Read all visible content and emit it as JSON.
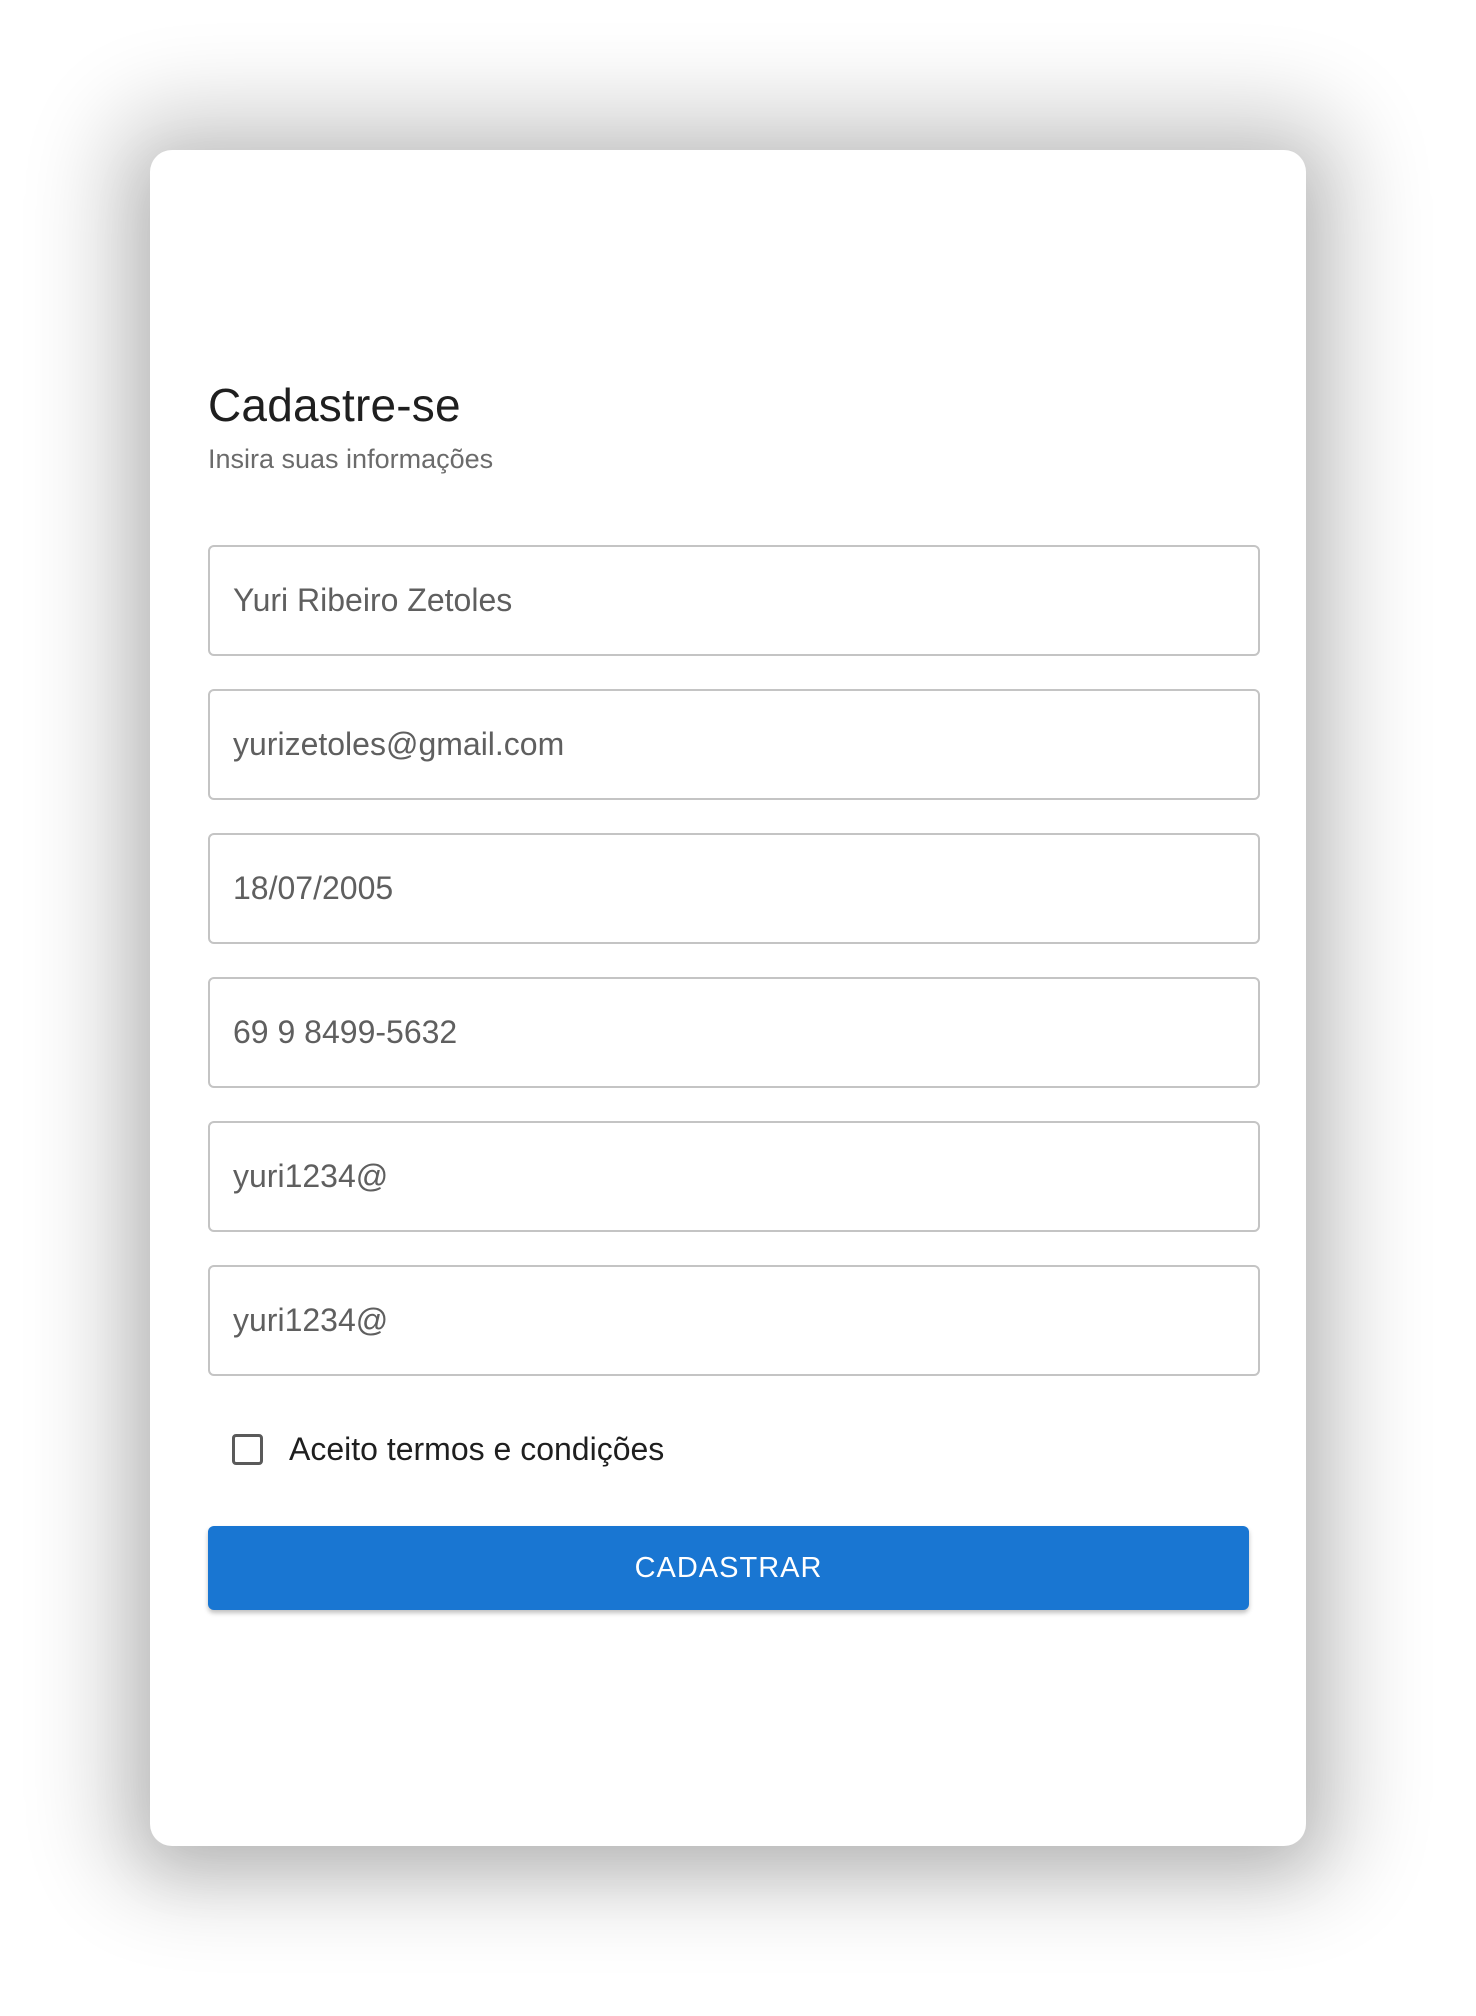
{
  "form": {
    "title": "Cadastre-se",
    "subtitle": "Insira suas informações",
    "fields": [
      {
        "value": "Yuri Ribeiro Zetoles"
      },
      {
        "value": "yurizetoles@gmail.com"
      },
      {
        "value": "18/07/2005"
      },
      {
        "value": "69 9 8499-5632"
      },
      {
        "value": "yuri1234@"
      },
      {
        "value": "yuri1234@"
      }
    ],
    "terms_label": "Aceito termos e condições",
    "terms_checked": false,
    "submit_label": "CADASTRAR"
  },
  "colors": {
    "primary": "#1976d2",
    "border": "#c4c4c4",
    "text": "#1f1f1f",
    "muted": "#6b6b6b"
  }
}
